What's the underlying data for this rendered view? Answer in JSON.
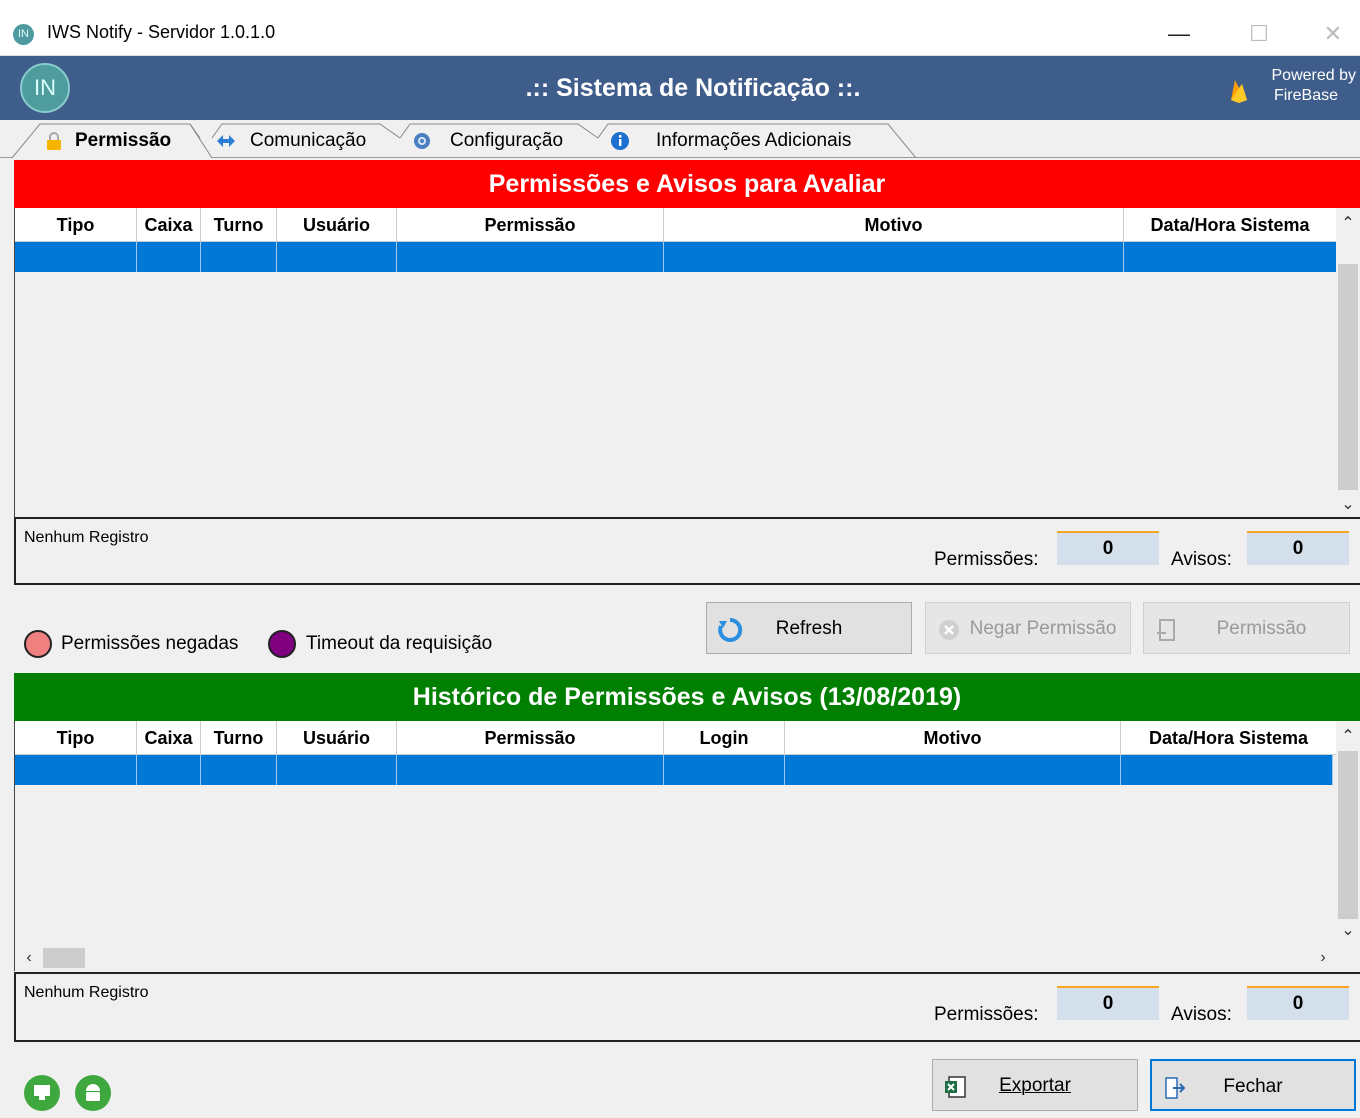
{
  "window": {
    "title": "IWS Notify - Servidor 1.0.1.0",
    "app_icon_text": "IN",
    "minimize_glyph": "—",
    "maximize_glyph": "☐",
    "close_glyph": "✕"
  },
  "header": {
    "logo_text": "IN",
    "title": ".:: Sistema de Notificação ::.",
    "powered_line1": "Powered by",
    "powered_line2": "FireBase"
  },
  "tabs": [
    {
      "label": "Permissão",
      "icon": "lock-icon",
      "active": true
    },
    {
      "label": "Comunicação",
      "icon": "arrows-icon",
      "active": false
    },
    {
      "label": "Configuração",
      "icon": "gear-icon",
      "active": false
    },
    {
      "label": "Informações Adicionais",
      "icon": "info-icon",
      "active": false
    }
  ],
  "pending": {
    "title": "Permissões e Avisos para Avaliar",
    "columns": [
      "Tipo",
      "Caixa",
      "Turno",
      "Usuário",
      "Permissão",
      "Motivo",
      "Data/Hora Sistema"
    ],
    "status": "Nenhum Registro",
    "permissions_label": "Permissões:",
    "permissions_count": "0",
    "notices_label": "Avisos:",
    "notices_count": "0"
  },
  "legend": {
    "denied": "Permissões negadas",
    "denied_color": "#f08080",
    "timeout": "Timeout da requisição",
    "timeout_color": "#800080"
  },
  "actions": {
    "refresh": "Refresh",
    "deny": "Negar Permissão",
    "permit": "Permissão"
  },
  "history": {
    "title": "Histórico de Permissões e Avisos (13/08/2019)",
    "columns": [
      "Tipo",
      "Caixa",
      "Turno",
      "Usuário",
      "Permissão",
      "Login",
      "Motivo",
      "Data/Hora Sistema"
    ],
    "status": "Nenhum Registro",
    "permissions_label": "Permissões:",
    "permissions_count": "0",
    "notices_label": "Avisos:",
    "notices_count": "0"
  },
  "bottom": {
    "export": "Exportar",
    "close": "Fechar"
  },
  "colors": {
    "header_bg": "#3f5d8a",
    "pending_bg": "#ff0000",
    "history_bg": "#007f00",
    "selection": "#0078d7"
  }
}
